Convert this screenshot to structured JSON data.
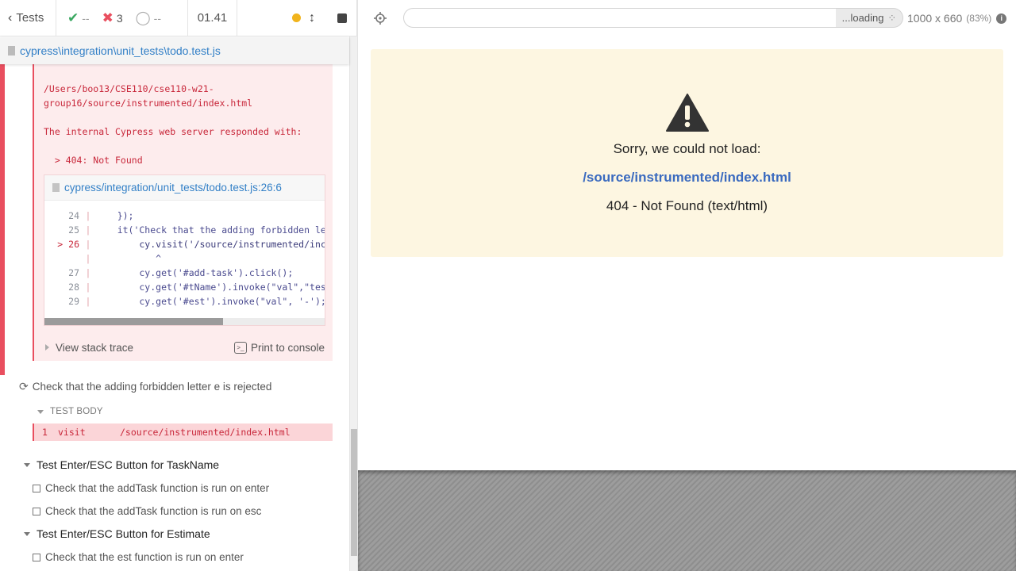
{
  "header": {
    "back_label": "Tests",
    "passed": "--",
    "failed": "3",
    "pending": "--",
    "timer": "01.41"
  },
  "spec_path": "cypress\\integration\\unit_tests\\todo.test.js",
  "error": {
    "path_line1": "/Users/boo13/CSE110/cse110-w21-",
    "path_line2": "group16/source/instrumented/index.html",
    "server_msg": "The internal Cypress web server responded with:",
    "status_line": "  > 404: Not Found",
    "code_file": "cypress/integration/unit_tests/todo.test.js:26:6",
    "code_lines": [
      {
        "num": "24",
        "src": "    });",
        "current": false
      },
      {
        "num": "25",
        "src": "    it('Check that the adding forbidden le",
        "current": false
      },
      {
        "num": "> 26",
        "src": "        cy.visit('/source/instrumented/inc",
        "current": true
      },
      {
        "num": "",
        "src": "           ^",
        "current": false
      },
      {
        "num": "27",
        "src": "        cy.get('#add-task').click();",
        "current": false
      },
      {
        "num": "28",
        "src": "        cy.get('#tName').invoke(\"val\",\"tes",
        "current": false
      },
      {
        "num": "29",
        "src": "        cy.get('#est').invoke(\"val\", '-');",
        "current": false
      }
    ],
    "view_stack_trace": "View stack trace",
    "print_to_console": "Print to console"
  },
  "running_test": "Check that the adding forbidden letter e is rejected",
  "test_body_label": "TEST BODY",
  "command": {
    "num": "1",
    "name": "visit",
    "arg": "/source/instrumented/index.html"
  },
  "suites": [
    {
      "title": "Test Enter/ESC Button for TaskName",
      "tests": [
        "Check that the addTask function is run on enter",
        "Check that the addTask function is run on esc"
      ]
    },
    {
      "title": "Test Enter/ESC Button for Estimate",
      "tests": [
        "Check that the est function is run on enter"
      ]
    }
  ],
  "aut": {
    "url_value": "",
    "loading": "...loading",
    "viewport": "1000 x 660",
    "zoom": "(83%)",
    "error_title": "Sorry, we could not load:",
    "error_url": "/source/instrumented/index.html",
    "error_status": "404 - Not Found (text/html)"
  }
}
